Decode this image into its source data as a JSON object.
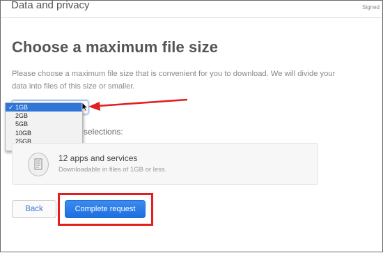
{
  "header": {
    "title": "Data and privacy",
    "signed": "Signed"
  },
  "page": {
    "heading": "Choose a maximum file size",
    "description": "Please choose a maximum file size that is convenient for you to download. We will divide your data into files of this size or smaller."
  },
  "size_select": {
    "selected": "1GB",
    "options": [
      "1GB",
      "2GB",
      "5GB",
      "10GB",
      "25GB"
    ]
  },
  "selections_label": "selections:",
  "summary": {
    "apps": "12 apps and services",
    "note": "Downloadable in files of 1GB or less."
  },
  "buttons": {
    "back": "Back",
    "complete": "Complete request"
  },
  "colors": {
    "accent": "#1c6fe0",
    "annotation": "#e41e1e"
  }
}
